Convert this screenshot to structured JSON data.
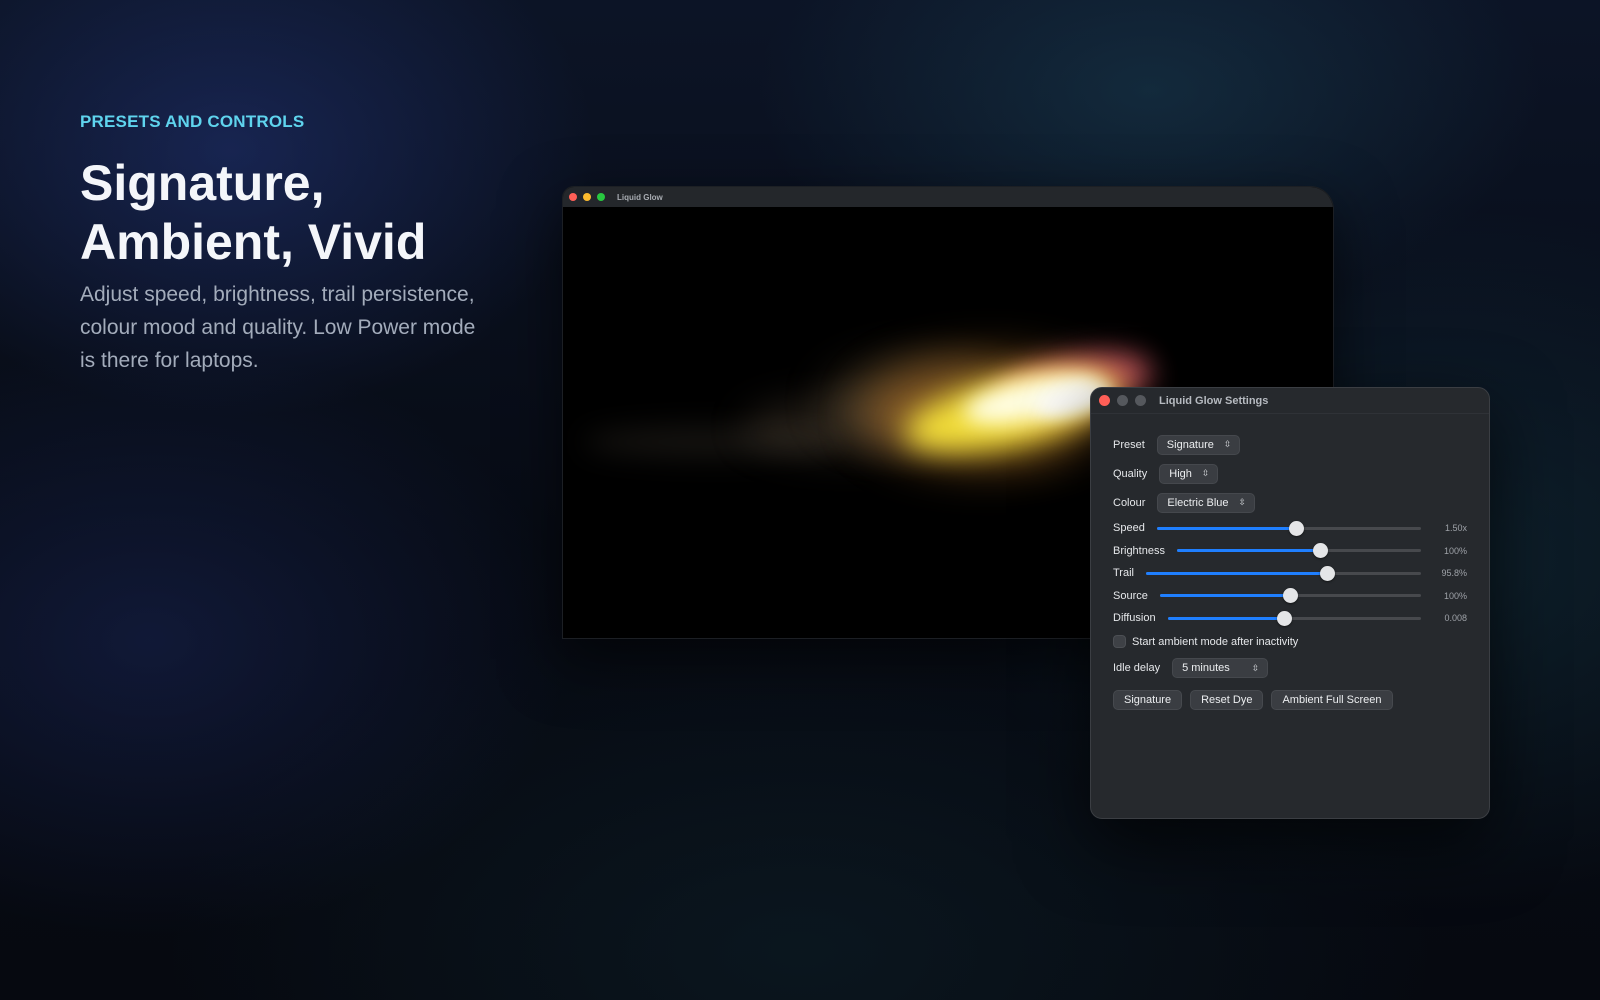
{
  "hero": {
    "eyebrow": "PRESETS AND CONTROLS",
    "headline": "Signature, Ambient, Vivid",
    "subcopy": "Adjust speed, brightness, trail persistence, colour mood and quality. Low Power mode is there for laptops."
  },
  "main_window": {
    "title": "Liquid Glow"
  },
  "settings": {
    "title": "Liquid Glow Settings",
    "preset": {
      "label": "Preset",
      "value": "Signature"
    },
    "quality": {
      "label": "Quality",
      "value": "High"
    },
    "colour": {
      "label": "Colour",
      "value": "Electric Blue"
    },
    "sliders": [
      {
        "label": "Speed",
        "value": "1.50x",
        "level": 0.53
      },
      {
        "label": "Brightness",
        "value": "100%",
        "level": 0.59
      },
      {
        "label": "Trail",
        "value": "95.8%",
        "level": 0.66
      },
      {
        "label": "Source",
        "value": "100%",
        "level": 0.5
      },
      {
        "label": "Diffusion",
        "value": "0.008",
        "level": 0.46
      }
    ],
    "ambient_checkbox": {
      "label": "Start ambient mode after inactivity",
      "checked": false
    },
    "idle_delay": {
      "label": "Idle delay",
      "value": "5 minutes"
    },
    "buttons": {
      "signature": "Signature",
      "reset_dye": "Reset Dye",
      "ambient_full_screen": "Ambient Full Screen"
    }
  },
  "icons": {
    "chevron": "chevron-up-down-icon"
  },
  "colors": {
    "accent": "#1f7fff",
    "eyebrow": "#5fd4ee"
  }
}
